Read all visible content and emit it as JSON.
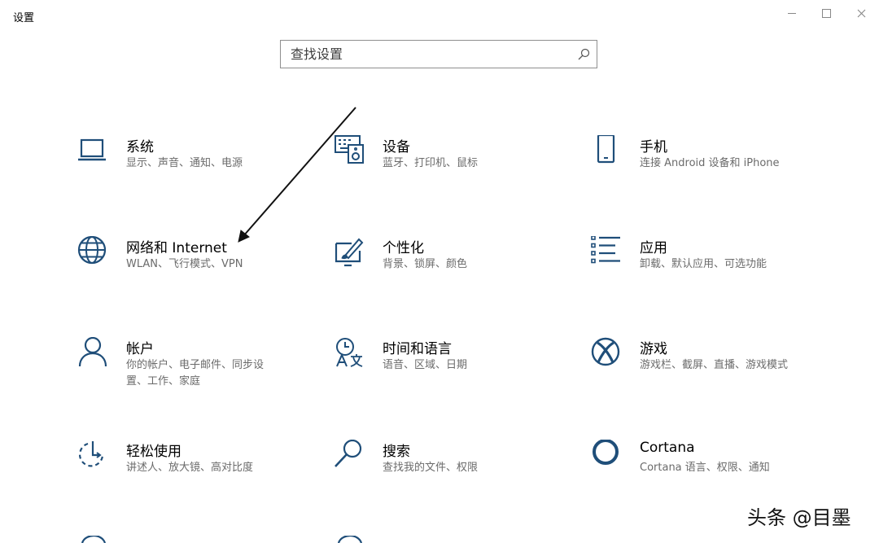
{
  "window": {
    "title": "设置",
    "minimize_icon": "minimize-icon",
    "maximize_icon": "maximize-icon",
    "close_icon": "close-icon"
  },
  "search": {
    "placeholder": "查找设置",
    "icon": "search-icon"
  },
  "tiles": [
    {
      "title": "系统",
      "desc": "显示、声音、通知、电源",
      "icon": "laptop-icon"
    },
    {
      "title": "设备",
      "desc": "蓝牙、打印机、鼠标",
      "icon": "keyboard-speaker-icon"
    },
    {
      "title": "手机",
      "desc": "连接 Android 设备和 iPhone",
      "icon": "phone-icon"
    },
    {
      "title": "网络和 Internet",
      "desc": "WLAN、飞行模式、VPN",
      "icon": "globe-icon"
    },
    {
      "title": "个性化",
      "desc": "背景、锁屏、颜色",
      "icon": "paint-icon"
    },
    {
      "title": "应用",
      "desc": "卸载、默认应用、可选功能",
      "icon": "app-list-icon"
    },
    {
      "title": "帐户",
      "desc": "你的帐户、电子邮件、同步设",
      "desc2": "置、工作、家庭",
      "icon": "person-icon"
    },
    {
      "title": "时间和语言",
      "desc": "语音、区域、日期",
      "icon": "time-language-icon"
    },
    {
      "title": "游戏",
      "desc": "游戏栏、截屏、直播、游戏模式",
      "icon": "xbox-icon"
    },
    {
      "title": "轻松使用",
      "desc": "讲述人、放大镜、高对比度",
      "icon": "ease-of-access-icon"
    },
    {
      "title": "搜索",
      "desc": "查找我的文件、权限",
      "icon": "magnifier-icon"
    },
    {
      "title": "Cortana",
      "desc": "Cortana 语言、权限、通知",
      "icon": "cortana-icon"
    }
  ],
  "watermark": "头条 @目墨"
}
